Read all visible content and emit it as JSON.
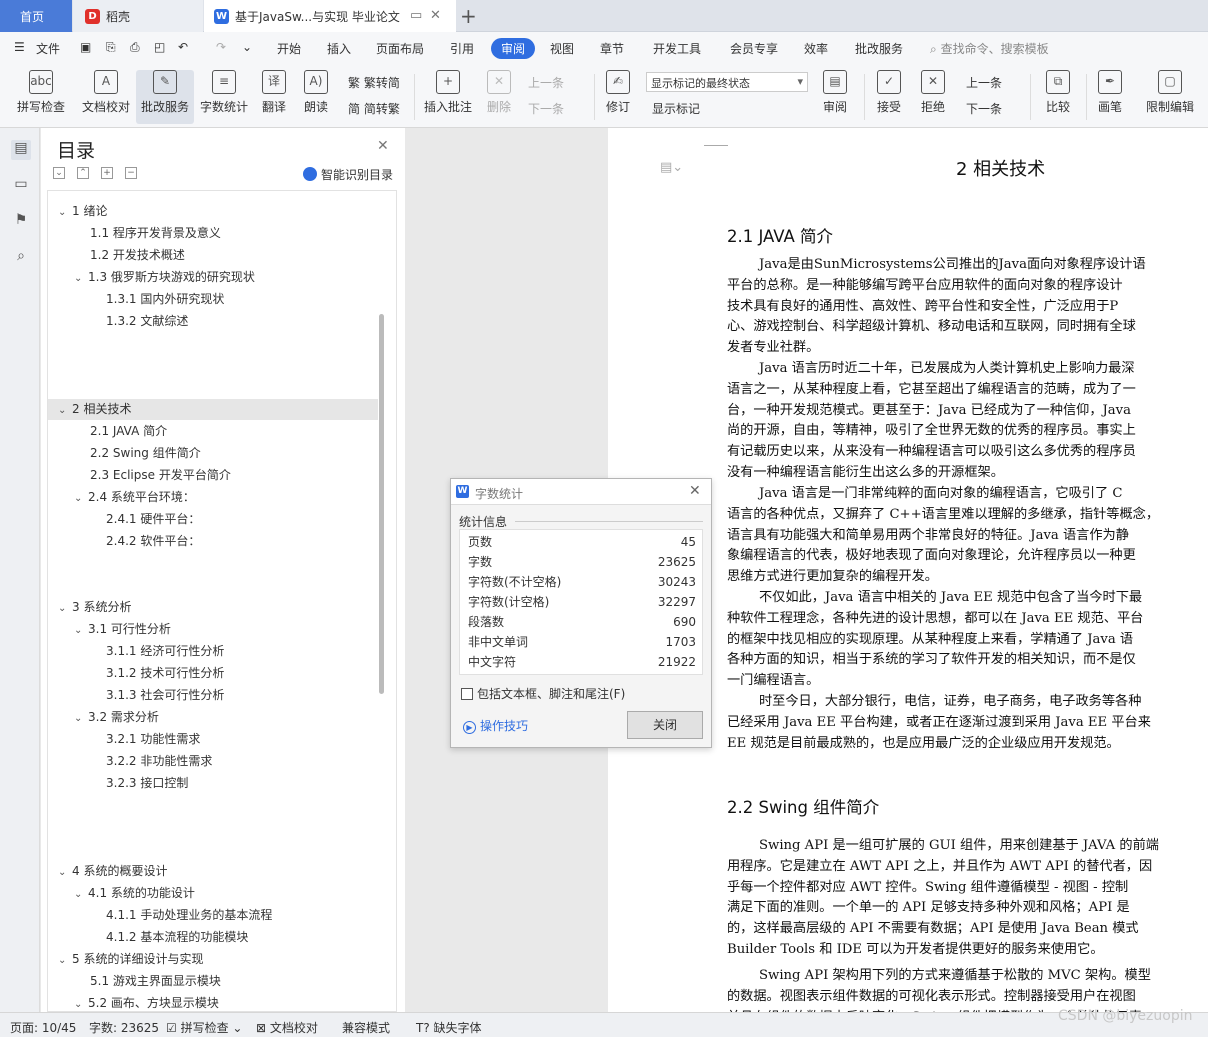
{
  "tabs": {
    "home": "首页",
    "docer": "稻壳",
    "document": "基于JavaSw...与实现 毕业论文"
  },
  "menu": {
    "file": "文件",
    "items": [
      "开始",
      "插入",
      "页面布局",
      "引用",
      "审阅",
      "视图",
      "章节",
      "开发工具",
      "会员专享",
      "效率",
      "批改服务"
    ],
    "search": "查找命令、搜索模板"
  },
  "ribbon": {
    "spell": "拼写检查",
    "proof": "文档校对",
    "correct": "批改服务",
    "wordcount": "字数统计",
    "translate": "翻译",
    "read": "朗读",
    "trad": "繁转简",
    "simp": "简转繁",
    "insert_comment": "插入批注",
    "delete": "删除",
    "prev": "上一条",
    "next": "下一条",
    "revise": "修订",
    "markup_select": "显示标记的最终状态",
    "show_markup": "显示标记",
    "review": "审阅",
    "accept": "接受",
    "reject": "拒绝",
    "prev2": "上一条",
    "next2": "下一条",
    "compare": "比较",
    "pen": "画笔",
    "restrict": "限制编辑"
  },
  "toc": {
    "title": "目录",
    "smart": "智能识别目录",
    "items": [
      {
        "t": "1  绪论"
      },
      {
        "t": "1.1 程序开发背景及意义"
      },
      {
        "t": "1.2 开发技术概述"
      },
      {
        "t": "1.3 俄罗斯方块游戏的研究现状"
      },
      {
        "t": "1.3.1  国内外研究现状"
      },
      {
        "t": "1.3.2  文献综述"
      },
      {
        "t": "2 相关技术"
      },
      {
        "t": "2.1 JAVA 简介"
      },
      {
        "t": "2.2 Swing 组件简介"
      },
      {
        "t": "2.3 Eclipse 开发平台简介"
      },
      {
        "t": "2.4 系统平台环境："
      },
      {
        "t": "2.4.1  硬件平台："
      },
      {
        "t": "2.4.2  软件平台："
      },
      {
        "t": "3    系统分析"
      },
      {
        "t": "3.1 可行性分析"
      },
      {
        "t": "3.1.1 经济可行性分析"
      },
      {
        "t": "3.1.2 技术可行性分析"
      },
      {
        "t": "3.1.3 社会可行性分析"
      },
      {
        "t": "3.2 需求分析"
      },
      {
        "t": "3.2.1  功能性需求"
      },
      {
        "t": "3.2.2  非功能性需求"
      },
      {
        "t": "3.2.3    接口控制"
      },
      {
        "t": "4    系统的概要设计"
      },
      {
        "t": "4.1    系统的功能设计"
      },
      {
        "t": "4.1.1    手动处理业务的基本流程"
      },
      {
        "t": "4.1.2    基本流程的功能模块"
      },
      {
        "t": "5    系统的详细设计与实现"
      },
      {
        "t": "5.1    游戏主界面显示模块"
      },
      {
        "t": "5.2    画布、方块显示模块"
      }
    ]
  },
  "doc": {
    "h1": "2 相关技术",
    "h2a": "2.1  JAVA 简介",
    "p1": [
      "Java是由SunMicrosystems公司推出的Java面向对象程序设计语",
      "平台的总称。是一种能够编写跨平台应用软件的面向对象的程序设计",
      "技术具有良好的通用性、高效性、跨平台性和安全性，广泛应用于P",
      "心、游戏控制台、科学超级计算机、移动电话和互联网，同时拥有全球",
      "发者专业社群。"
    ],
    "p2": [
      "Java 语言历时近二十年，已发展成为人类计算机史上影响力最深",
      "语言之一，从某种程度上看，它甚至超出了编程语言的范畴，成为了一",
      "台，一种开发规范模式。更甚至于：Java 已经成为了一种信仰，Java",
      "尚的开源，自由，等精神，吸引了全世界无数的优秀的程序员。事实上",
      "有记载历史以来，从来没有一种编程语言可以吸引这么多优秀的程序员",
      "没有一种编程语言能衍生出这么多的开源框架。"
    ],
    "p3": [
      "Java 语言是一门非常纯粹的面向对象的编程语言，它吸引了 C",
      "语言的各种优点，又摒弃了 C++语言里难以理解的多继承，指针等概念，",
      "语言具有功能强大和简单易用两个非常良好的特征。Java 语言作为静",
      "象编程语言的代表，极好地表现了面向对象理论，允许程序员以一种更",
      "思维方式进行更加复杂的编程开发。"
    ],
    "p4": [
      "不仅如此，Java 语言中相关的 Java EE 规范中包含了当今时下最",
      "种软件工程理念，各种先进的设计思想，都可以在 Java EE 规范、平台",
      "的框架中找见相应的实现原理。从某种程度上来看，学精通了 Java 语",
      "各种方面的知识，相当于系统的学习了软件开发的相关知识，而不是仅",
      "一门编程语言。"
    ],
    "p5": [
      "时至今日，大部分银行，电信，证券，电子商务，电子政务等各种",
      "已经采用 Java EE 平台构建，或者正在逐渐过渡到采用 Java EE 平台来",
      "EE 规范是目前最成熟的，也是应用最广泛的企业级应用开发规范。"
    ],
    "h2b": "2.2 Swing 组件简介",
    "p6": [
      "Swing API 是一组可扩展的 GUI 组件，用来创建基于 JAVA 的前端",
      "用程序。它是建立在 AWT API 之上，并且作为 AWT API 的替代者，因",
      "乎每一个控件都对应 AWT 控件。Swing 组件遵循模型 - 视图 - 控制",
      "满足下面的准则。一个单一的 API 足够支持多种外观和风格；API 是",
      "的，这样最高层级的 API 不需要有数据；API 是使用 Java Bean 模式",
      "Builder Tools 和 IDE 可以为开发者提供更好的服务来使用它。"
    ],
    "p7": [
      "Swing API 架构用下列的方式来遵循基于松散的 MVC 架构。模型",
      "的数据。视图表示组件数据的可视化表示形式。控制器接受用户在视图",
      "并且在组件的数据中反映变化。Swing 组件把模型作为一个单独的元素"
    ]
  },
  "dialog": {
    "title": "字数统计",
    "section": "统计信息",
    "rows": [
      {
        "label": "页数",
        "value": "45"
      },
      {
        "label": "字数",
        "value": "23625"
      },
      {
        "label": "字符数(不计空格)",
        "value": "30243"
      },
      {
        "label": "字符数(计空格)",
        "value": "32297"
      },
      {
        "label": "段落数",
        "value": "690"
      },
      {
        "label": "非中文单词",
        "value": "1703"
      },
      {
        "label": "中文字符",
        "value": "21922"
      }
    ],
    "include": "包括文本框、脚注和尾注(F)",
    "tips": "操作技巧",
    "close": "关闭"
  },
  "status": {
    "page": "页面: 10/45",
    "words": "字数: 23625",
    "spell": "拼写检查",
    "proof": "文档校对",
    "compat": "兼容模式",
    "font": "缺失字体"
  },
  "watermark": "CSDN @biyezuopin",
  "colors": {
    "accent": "#2f6de0",
    "home_tab": "#4a7bd8"
  }
}
